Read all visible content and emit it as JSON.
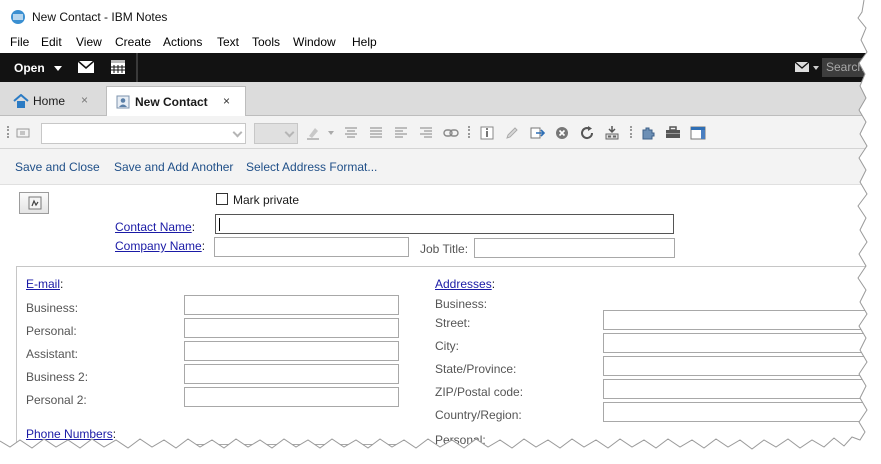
{
  "window": {
    "title": "New Contact - IBM Notes"
  },
  "menu": [
    "File",
    "Edit",
    "View",
    "Create",
    "Actions",
    "Text",
    "Tools",
    "Window",
    "Help"
  ],
  "topbar": {
    "open_label": "Open",
    "search_placeholder": "Search"
  },
  "tabs": [
    {
      "label": "Home",
      "close": "×"
    },
    {
      "label": "New Contact",
      "close": "×"
    }
  ],
  "actions": [
    "Save and Close",
    "Save and Add Another",
    "Select Address Format..."
  ],
  "form": {
    "mark_private": "Mark private",
    "contact_name_label": "Contact Name",
    "company_name_label": "Company Name",
    "job_title_label": "Job Title:",
    "colon": ":",
    "contact_name_value": "",
    "company_name_value": "",
    "job_title_value": ""
  },
  "email": {
    "header": "E-mail",
    "fields": [
      "Business:",
      "Personal:",
      "Assistant:",
      "Business 2:",
      "Personal 2:"
    ]
  },
  "phone": {
    "header": "Phone Numbers"
  },
  "addresses": {
    "header": "Addresses",
    "business_label": "Business:",
    "fields": [
      "Street:",
      "City:",
      "State/Province:",
      "ZIP/Postal code:",
      "Country/Region:"
    ],
    "personal_label": "Personal:"
  },
  "colors": {
    "accent_link": "#1a1aa6",
    "action_text": "#1f4f88",
    "topbar_bg": "#121212",
    "tab_home_icon": "#2b7bc4"
  }
}
